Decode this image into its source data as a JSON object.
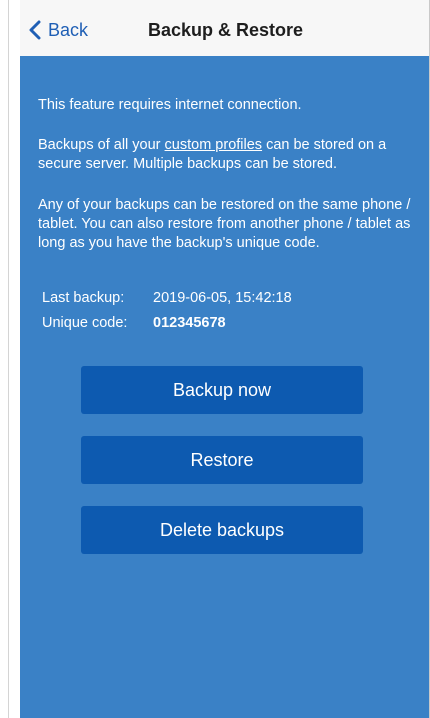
{
  "header": {
    "back_label": "Back",
    "title": "Backup & Restore"
  },
  "content": {
    "notice": "This feature requires internet connection.",
    "para2_before": "Backups of all your ",
    "para2_link": "custom profiles",
    "para2_after": " can be stored on a secure server. Multiple backups can be stored.",
    "para3": "Any of your backups can be restored on the same phone / tablet. You can also restore from another phone / tablet as long as you have the backup's unique code.",
    "last_backup_label": "Last backup:",
    "last_backup_value": "2019-06-05, 15:42:18",
    "unique_code_label": "Unique code:",
    "unique_code_value": "012345678"
  },
  "buttons": {
    "backup_now": "Backup now",
    "restore": "Restore",
    "delete_backups": "Delete backups"
  },
  "icons": {
    "back": "chevron-left-icon"
  },
  "colors": {
    "panel": "#3a81c6",
    "button": "#0d5ab0",
    "accent": "#1f5fb5"
  }
}
